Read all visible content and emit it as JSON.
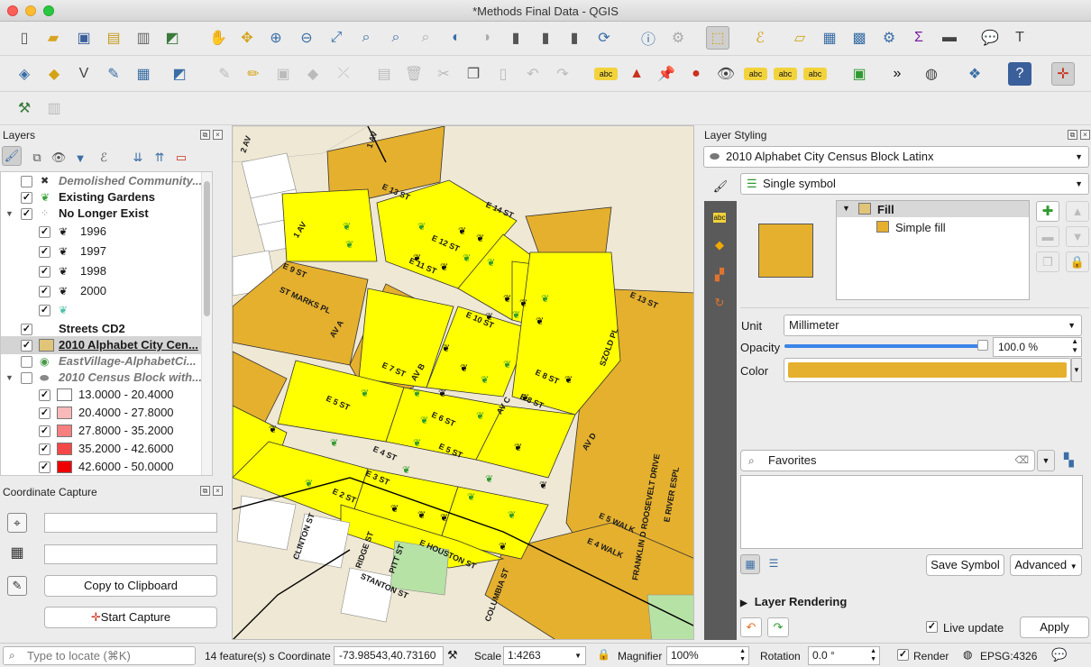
{
  "window": {
    "title": "*Methods Final Data - QGIS"
  },
  "layers_panel": {
    "title": "Layers",
    "items": [
      {
        "label": "Demolished Community...",
        "checked": false,
        "style": "italic-grey",
        "icon": "x-marker-icon"
      },
      {
        "label": "Existing Gardens",
        "checked": true,
        "style": "bold",
        "icon": "leaf-icon"
      },
      {
        "label": "No Longer Exist",
        "checked": true,
        "style": "bold",
        "icon": "leaf-group-icon"
      },
      {
        "label": "1996",
        "checked": true,
        "style": "normal",
        "icon": "leaf-icon"
      },
      {
        "label": "1997",
        "checked": true,
        "style": "normal",
        "icon": "leaf-icon"
      },
      {
        "label": "1998",
        "checked": true,
        "style": "normal",
        "icon": "leaf-icon"
      },
      {
        "label": "2000",
        "checked": true,
        "style": "normal",
        "icon": "leaf-icon"
      },
      {
        "label": "",
        "checked": true,
        "style": "normal",
        "icon": "leaf-green-icon"
      },
      {
        "label": "Streets CD2",
        "checked": true,
        "style": "bold",
        "icon": ""
      },
      {
        "label": "2010 Alphabet City Cen...",
        "checked": true,
        "style": "bold-underline",
        "icon": "fill-swatch-icon"
      },
      {
        "label": "EastVillage-AlphabetCi...",
        "checked": false,
        "style": "italic-grey",
        "icon": "globe-icon"
      },
      {
        "label": "2010 Census Block with...",
        "checked": false,
        "style": "italic-grey",
        "icon": "polygon-icon"
      },
      {
        "label": "13.0000 - 20.4000",
        "checked": true,
        "style": "normal",
        "swatch": "#ffffff"
      },
      {
        "label": "20.4000 - 27.8000",
        "checked": true,
        "style": "normal",
        "swatch": "#f9b9b9"
      },
      {
        "label": "27.8000 - 35.2000",
        "checked": true,
        "style": "normal",
        "swatch": "#f77f7f"
      },
      {
        "label": "35.2000 - 42.6000",
        "checked": true,
        "style": "normal",
        "swatch": "#f44848"
      },
      {
        "label": "42.6000 - 50.0000",
        "checked": true,
        "style": "normal",
        "swatch": "#ee0000"
      }
    ]
  },
  "coordinate_capture": {
    "title": "Coordinate Capture",
    "field1": "",
    "field2": "",
    "copy_label": "Copy to Clipboard",
    "start_label": "Start Capture"
  },
  "map": {
    "labels": [
      "E 13 ST",
      "E 14 ST",
      "E 12 ST",
      "E 11 ST",
      "1 AV",
      "E 9 ST",
      "ST MARKS PL",
      "AV A",
      "E 10 ST",
      "E 13 ST",
      "E 7 ST",
      "AV B",
      "E 8 ST",
      "E 8 ST",
      "SZOLD PL",
      "E 5 ST",
      "E 6 ST",
      "AV C",
      "AV D",
      "E 4 ST",
      "E 5 ST",
      "E 3 ST",
      "E 2 ST",
      "E HOUSTON ST",
      "E 5 WALK",
      "E 4 WALK",
      "FRANKLIN D ROOSEVELT DRIVE",
      "E RIVER ESPL",
      "CLINTON ST",
      "RIDGE ST",
      "PITT ST",
      "STANTON ST",
      "COLUMBIA ST",
      "2 AV",
      "1 AV"
    ]
  },
  "layer_styling": {
    "title": "Layer Styling",
    "layer": "2010 Alphabet City Census Block Latinx",
    "renderer": "Single symbol",
    "tree": {
      "fill_label": "Fill",
      "simple_fill_label": "Simple fill"
    },
    "symbol_color": "#e5b02e",
    "unit_label": "Unit",
    "unit_value": "Millimeter",
    "opacity_label": "Opacity",
    "opacity_value": "100.0 %",
    "opacity_fraction": 1.0,
    "color_label": "Color",
    "search_placeholder": "Favorites",
    "save_symbol": "Save Symbol",
    "advanced": "Advanced",
    "rendering_label": "Layer Rendering",
    "live_update": "Live update",
    "apply": "Apply"
  },
  "status": {
    "locate_placeholder": "Type to locate (⌘K)",
    "features": "14 feature(s) s",
    "coordinate_label": "Coordinate",
    "coordinate_value": "-73.98543,40.73160",
    "scale_label": "Scale",
    "scale_value": "1:4263",
    "magnifier_label": "Magnifier",
    "magnifier_value": "100%",
    "rotation_label": "Rotation",
    "rotation_value": "0.0 °",
    "render_label": "Render",
    "crs": "EPSG:4326"
  }
}
